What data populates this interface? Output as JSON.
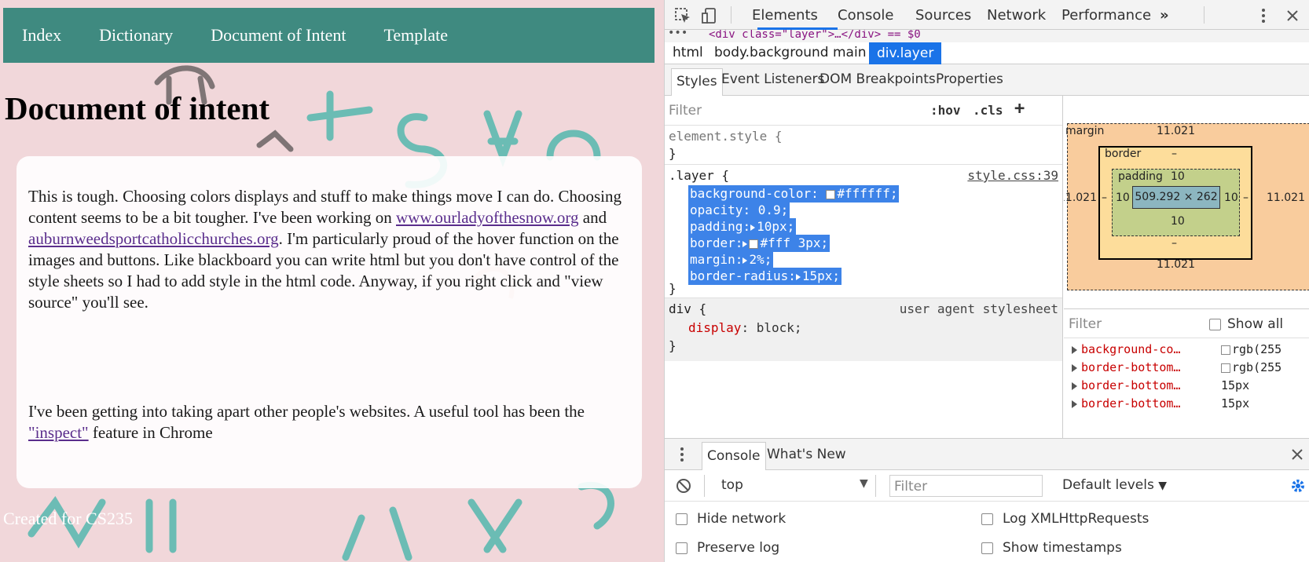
{
  "page": {
    "nav": [
      "Index",
      "Dictionary",
      "Document of Intent",
      "Template"
    ],
    "title": "Document of intent",
    "para1_a": "This is tough. Choosing colors displays and stuff to make things move I can do. Choosing content seems to be a bit tougher. I've been working on ",
    "link1": "www.ourladyofthesnow.org",
    "para1_b": " and ",
    "link2": "auburnweedsportcatholicchurches.org",
    "para1_c": ". I'm particularly proud of the hover function on the images and buttons. Like blackboard you can write html but you don't have control of the style sheets so I had to add style in the html code. Anyway, if you right click and \"view source\" you'll see.",
    "para2_a": "I've been getting into taking apart other people's websites. A useful tool has been the ",
    "link3": "\"inspect\"",
    "para2_b": " feature in Chrome",
    "footer": "Created for CS235",
    "nav_color": "#3f8a80"
  },
  "devtools": {
    "tabs": [
      "Elements",
      "Console",
      "Sources",
      "Network",
      "Performance"
    ],
    "more": "»",
    "menu_icon": "vertical-dots-icon",
    "dom_line": "<div class=\"layer\">…</div> == $0",
    "breadcrumbs": [
      "html",
      "body.background",
      "main",
      "div.layer"
    ],
    "subtabs": [
      "Styles",
      "Event Listeners",
      "DOM Breakpoints",
      "Properties"
    ],
    "filter_placeholder": "Filter",
    "hov": ":hov",
    "cls": ".cls",
    "plus": "+",
    "element_style": "element.style {",
    "close_brace": "}",
    "layer_selector": ".layer {",
    "layer_source": "style.css:39",
    "layer_decls": [
      {
        "prop": "background-color",
        "value": "#ffffff;",
        "swatch": true,
        "tri": false
      },
      {
        "prop": "opacity",
        "value": "0.9;",
        "swatch": false,
        "tri": false
      },
      {
        "prop": "padding",
        "value": "10px;",
        "swatch": false,
        "tri": true
      },
      {
        "prop": "border",
        "value": "#fff 3px;",
        "swatch": true,
        "tri": true
      },
      {
        "prop": "margin",
        "value": "2%;",
        "swatch": false,
        "tri": true
      },
      {
        "prop": "border-radius",
        "value": "15px;",
        "swatch": false,
        "tri": true
      }
    ],
    "div_selector": "div {",
    "div_source": "user agent stylesheet",
    "div_decl_prop": "display",
    "div_decl_value": "block;",
    "boxmodel": {
      "margin_label": "margin",
      "margin_top": "11.021",
      "margin_bottom": "11.021",
      "margin_left": "11.021",
      "margin_right": "11.021",
      "border_label": "border",
      "border_top": "–",
      "border_bottom": "–",
      "border_left": "–",
      "border_right": "–",
      "padding_label": "padding",
      "padding_top": "10",
      "padding_bottom": "10",
      "padding_left": "10",
      "padding_right": "10",
      "content": "509.292 × 262"
    },
    "computed_filter": "Filter",
    "show_all": "Show all",
    "computed": [
      {
        "prop": "background-co…",
        "value": "rgb(255"
      },
      {
        "prop": "border-bottom…",
        "value": "rgb(255"
      },
      {
        "prop": "border-bottom…",
        "value": "15px"
      },
      {
        "prop": "border-bottom…",
        "value": "15px"
      }
    ],
    "drawer_tabs": [
      "Console",
      "What's New"
    ],
    "context": "top",
    "console_filter": "Filter",
    "levels": "Default levels",
    "options": [
      "Hide network",
      "Log XMLHttpRequests",
      "Preserve log",
      "Show timestamps"
    ]
  }
}
